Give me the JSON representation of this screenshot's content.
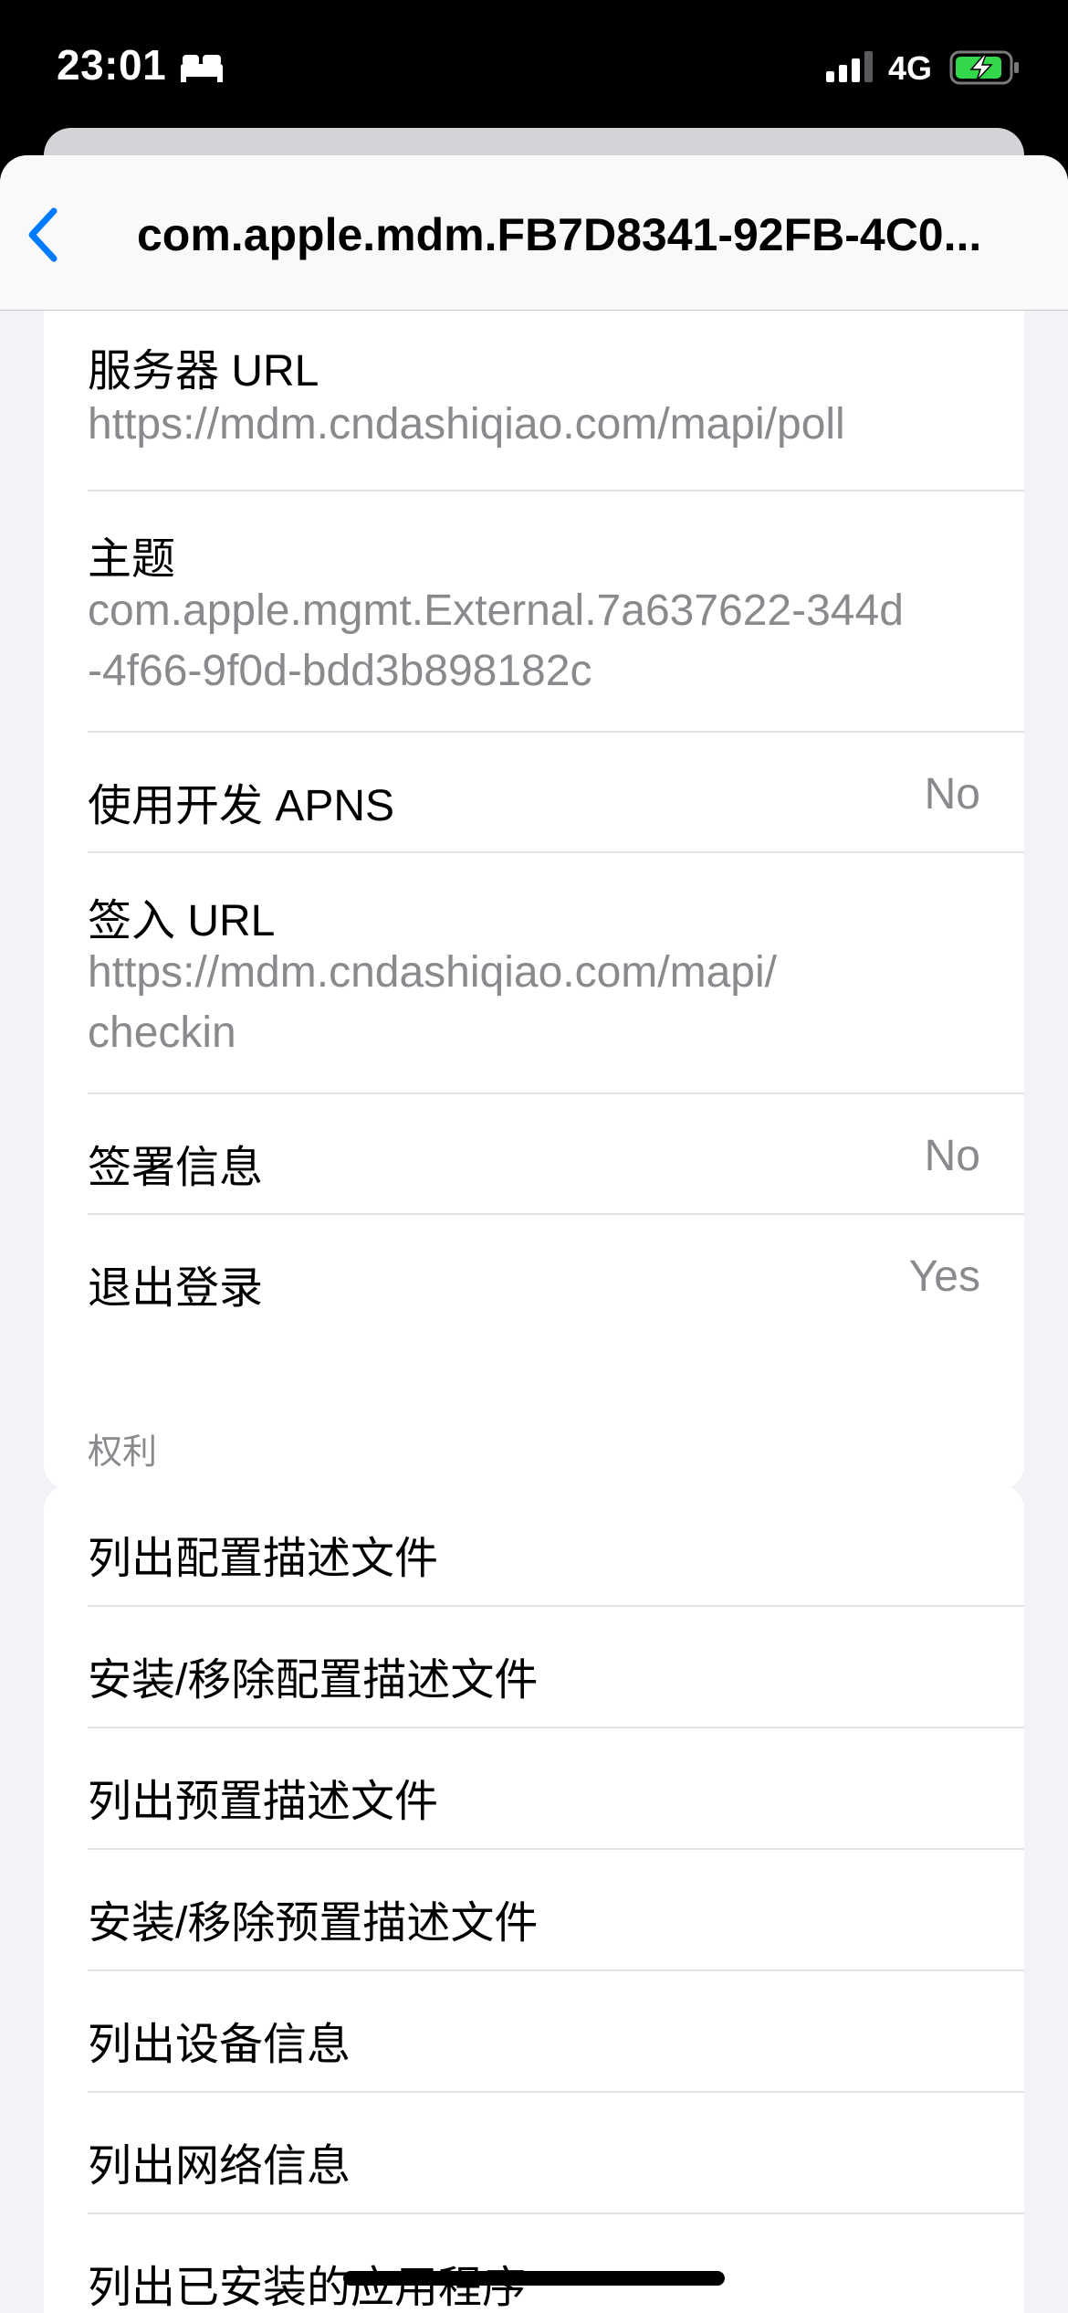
{
  "status_bar": {
    "time": "23:01",
    "network": "4G",
    "icons": [
      "sleep-bed-icon",
      "cellular-signal-icon",
      "battery-charging-icon"
    ],
    "battery_color": "#32d74b"
  },
  "nav": {
    "back_icon": "chevron-left-icon",
    "title": "com.apple.mdm.FB7D8341-92FB-4C0..."
  },
  "details": [
    {
      "label": "服务器 URL",
      "sub": "https://mdm.cndashiqiao.com/mapi/poll"
    },
    {
      "label": "主题",
      "sub_lines": [
        "com.apple.mgmt.External.7a637622-344d",
        "-4f66-9f0d-bdd3b898182c"
      ]
    },
    {
      "label": "使用开发 APNS",
      "value": "No"
    },
    {
      "label": "签入 URL",
      "sub_lines": [
        "https://mdm.cndashiqiao.com/mapi/",
        "checkin"
      ]
    },
    {
      "label": "签署信息",
      "value": "No"
    },
    {
      "label": "退出登录",
      "value": "Yes"
    }
  ],
  "rights": {
    "header": "权利",
    "items": [
      "列出配置描述文件",
      "安装/移除配置描述文件",
      "列出预置描述文件",
      "安装/移除预置描述文件",
      "列出设备信息",
      "列出网络信息",
      "列出已安装的应用程序"
    ]
  },
  "colors": {
    "accent": "#007aff",
    "background": "#f2f2f7",
    "secondary_text": "#8a8a8e"
  }
}
